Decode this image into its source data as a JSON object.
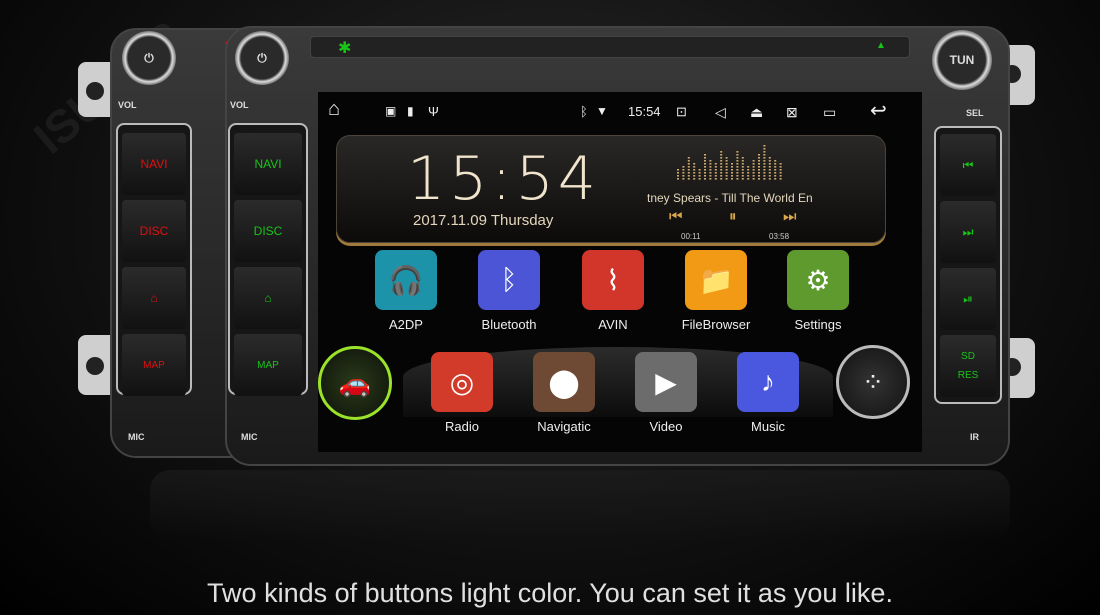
{
  "watermark": "ISUDAR",
  "colors": {
    "red_backlight": "#e01010",
    "green_backlight": "#19c419",
    "gold": "#d9b981",
    "car_ring": "#9be22a"
  },
  "back_unit": {
    "vol": "VOL",
    "buttons": [
      "NAVI",
      "DISC",
      "home",
      "MAP"
    ],
    "mic": "MIC"
  },
  "front_unit": {
    "vol": "VOL",
    "buttons": [
      "NAVI",
      "DISC",
      "home",
      "MAP"
    ],
    "mic": "MIC"
  },
  "right_panel": {
    "knob": "TUN",
    "sel": "SEL",
    "buttons": [
      "prev-icon",
      "next-icon",
      "play-pause-icon"
    ],
    "sd": "SD",
    "res": "RES",
    "ir": "IR"
  },
  "status_bar": {
    "time": "15:54",
    "icons": [
      "home-icon",
      "image-icon",
      "sd-card-icon",
      "usb-icon",
      "bluetooth-icon",
      "wifi-icon",
      "screenshot-icon",
      "volume-icon",
      "eject-icon",
      "screen-off-icon",
      "recent-apps-icon",
      "back-icon"
    ]
  },
  "clock_widget": {
    "time": "15:54",
    "date": "2017.11.09 Thursday"
  },
  "music_widget": {
    "track": "tney Spears - Till The World En",
    "elapsed": "00:11",
    "duration": "03:58",
    "prev": "⏮",
    "pause": "⏸",
    "next": "⏭"
  },
  "apps_row1": [
    {
      "label": "A2DP",
      "icon": "a2dp-headphones-icon",
      "color": "#1c93a8"
    },
    {
      "label": "Bluetooth",
      "icon": "bluetooth-icon",
      "color": "#4b55d6"
    },
    {
      "label": "AVIN",
      "icon": "avin-cable-icon",
      "color": "#d2352a"
    },
    {
      "label": "FileBrowser",
      "icon": "folder-icon",
      "color": "#f29a16"
    },
    {
      "label": "Settings",
      "icon": "gear-icon",
      "color": "#5e9a2e"
    }
  ],
  "apps_row2": [
    {
      "label": "Radio",
      "icon": "radio-icon",
      "color": "#d23a2a"
    },
    {
      "label": "Navigatic",
      "icon": "map-pin-icon",
      "color": "#6e4a34"
    },
    {
      "label": "Video",
      "icon": "play-icon",
      "color": "#6c6c6c"
    },
    {
      "label": "Music",
      "icon": "music-note-icon",
      "color": "#4a58e0"
    }
  ],
  "caption": "Two kinds of buttons light color. You can set it as you like."
}
